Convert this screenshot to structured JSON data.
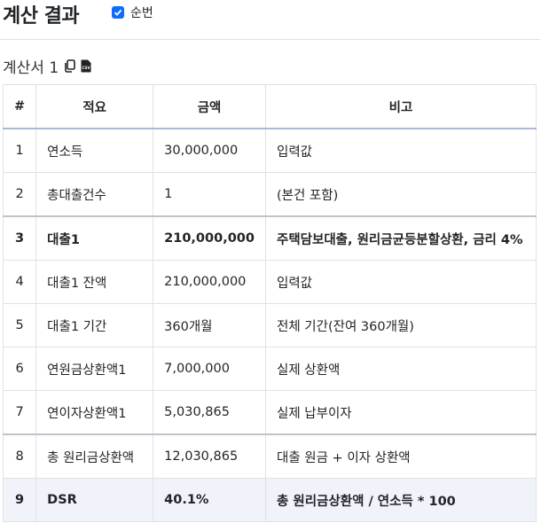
{
  "header": {
    "title": "계산 결과",
    "checkbox_label": "순번",
    "checkbox_checked": true
  },
  "subtitle": {
    "text": "계산서 1",
    "copy_icon": "copy-icon",
    "csv_icon": "csv-file-icon",
    "csv_badge": "CSV"
  },
  "table": {
    "headers": [
      "#",
      "적요",
      "금액",
      "비고"
    ],
    "rows": [
      {
        "no": "1",
        "desc": "연소득",
        "amount": "30,000,000",
        "note": "입력값"
      },
      {
        "no": "2",
        "desc": "총대출건수",
        "amount": "1",
        "note": "(본건 포함)"
      },
      {
        "no": "3",
        "desc": "대출1",
        "amount": "210,000,000",
        "note": "주택담보대출, 원리금균등분할상환, 금리 4%"
      },
      {
        "no": "4",
        "desc": "대출1 잔액",
        "amount": "210,000,000",
        "note": "입력값"
      },
      {
        "no": "5",
        "desc": "대출1 기간",
        "amount": "360개월",
        "note": "전체 기간(잔여 360개월)"
      },
      {
        "no": "6",
        "desc": "연원금상환액1",
        "amount": "7,000,000",
        "note": "실제 상환액"
      },
      {
        "no": "7",
        "desc": "연이자상환액1",
        "amount": "5,030,865",
        "note": "실제 납부이자"
      },
      {
        "no": "8",
        "desc": "총 원리금상환액",
        "amount": "12,030,865",
        "note": "대출 원금 + 이자 상환액"
      },
      {
        "no": "9",
        "desc": "DSR",
        "amount": "40.1%",
        "note": "총 원리금상환액 / 연소득 * 100"
      }
    ]
  }
}
